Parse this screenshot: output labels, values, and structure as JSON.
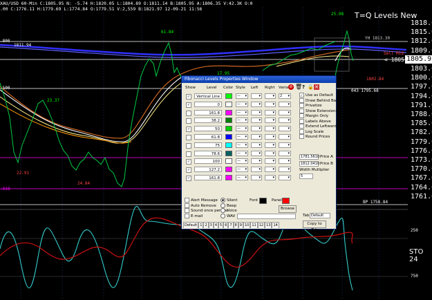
{
  "infobar": "XAU/USD 60-Min  C:1805.95  N: -5.74  H:1820.05  L:1804.89  O:1811.14  B:1805.95  A:1806.35  V:42.3K  O:0",
  "infobar2": ".00  C:1776.11  H:1779.69  L:1774.84  O:1779.51  V:2,559  B:1821.97  12-09-21  11:56",
  "title": "T=Q Levels New",
  "axis_prices": [
    "1818.00",
    "1815.00",
    "1812.00",
    "1809.00",
    "1806.00",
    "1803.00",
    "1800.00",
    "1797.00",
    "1794.00",
    "1791.00",
    "1788.00",
    "1785.00",
    "1782.00",
    "1779.00",
    "1776.00",
    "1773.00",
    "1770.00",
    "1767.00",
    "1764.00",
    "1761.00"
  ],
  "current_price": "1805.95",
  "price_tag": "< 1805",
  "sto_label": "STO 24",
  "osc_axis": [
    "250",
    "750"
  ],
  "chart_tags": {
    "t1": "1811.94",
    "t2": "23.37",
    "t3": "22.91",
    "t4": "24.84",
    "t5": "61.84",
    "t6": "17.95",
    "t7": "25.98",
    "t8": "YH 1813.30",
    "t9": "Sell  Mid",
    "t10": "1802.84",
    "t11": "043 1795.68",
    "t12": "BP 1758.84",
    "t13": ".800",
    "t14": ".500",
    "t15": ".818"
  },
  "dialog": {
    "title": "Fibonacci Levels Properties Window",
    "headers": {
      "show": "Show",
      "level": "Level",
      "color": "Color",
      "style": "Style",
      "left": "Left",
      "right": "Right",
      "variable": "Variable"
    },
    "levels": [
      {
        "checked": "✓",
        "level": "Vertical Line",
        "color": "#00ff00",
        "style": "—",
        "left": "",
        "right": "",
        "variable": "2"
      },
      {
        "checked": "✓",
        "level": "0",
        "color": "#ffffff",
        "style": "—",
        "left": "",
        "right": "",
        "variable": ""
      },
      {
        "checked": "",
        "level": "161.8",
        "color": "#ff00ff",
        "style": "—",
        "left": "",
        "right": "",
        "variable": ""
      },
      {
        "checked": "",
        "level": "38.2",
        "color": "#008000",
        "style": "—",
        "left": "",
        "right": "",
        "variable": ""
      },
      {
        "checked": "✓",
        "level": "50",
        "color": "#00cc00",
        "style": "—",
        "left": "",
        "right": "",
        "variable": ""
      },
      {
        "checked": "",
        "level": "61.8",
        "color": "#0000ff",
        "style": "—",
        "left": "",
        "right": "",
        "variable": ""
      },
      {
        "checked": "",
        "level": "75",
        "color": "#00ffff",
        "style": "—",
        "left": "",
        "right": "",
        "variable": ""
      },
      {
        "checked": "",
        "level": "78.6",
        "color": "#006060",
        "style": "—",
        "left": "",
        "right": "",
        "variable": ""
      },
      {
        "checked": "✓",
        "level": "100",
        "color": "#ffffff",
        "style": "—",
        "left": "",
        "right": "",
        "variable": ""
      },
      {
        "checked": "✓",
        "level": "127.2",
        "color": "#ff00ff",
        "style": "—",
        "left": "",
        "right": "",
        "variable": ""
      },
      {
        "checked": "✓",
        "level": "161.8",
        "color": "#ff00ff",
        "style": "—",
        "left": "",
        "right": "",
        "variable": ""
      }
    ],
    "options": [
      "Use as Default",
      "Draw Behind Bars",
      "Privatize",
      "Show Extensions",
      "Margin Only",
      "Labels Above",
      "Extend Leftward",
      "Log Scale",
      "Round Prices"
    ],
    "options_checked": [
      "✓",
      "",
      "",
      "",
      "",
      "",
      "",
      "",
      ""
    ],
    "price_a_label": "Price A",
    "price_a": "1781.5610",
    "price_b_label": "Price B",
    "price_b": "1812.0410",
    "width_multiplier_label": "Width Multiplier",
    "width_multiplier": "5",
    "alerts": [
      "Alert Message",
      "Auto Remove",
      "Sound once per bar",
      "E-mail"
    ],
    "sounds": [
      "Silent",
      "Beep",
      "Voice",
      "WAV"
    ],
    "font_label": "Font",
    "panel_label": "Panel",
    "browse": "Browse",
    "tab_label": "Tab",
    "tab_value": "Default",
    "copy_to_tab": "Copy to Tab",
    "tabs": [
      "Default",
      "1",
      "2",
      "3",
      "4",
      "5",
      "6",
      "7",
      "8",
      "9",
      "10",
      "11",
      "12",
      "13",
      "14"
    ]
  }
}
